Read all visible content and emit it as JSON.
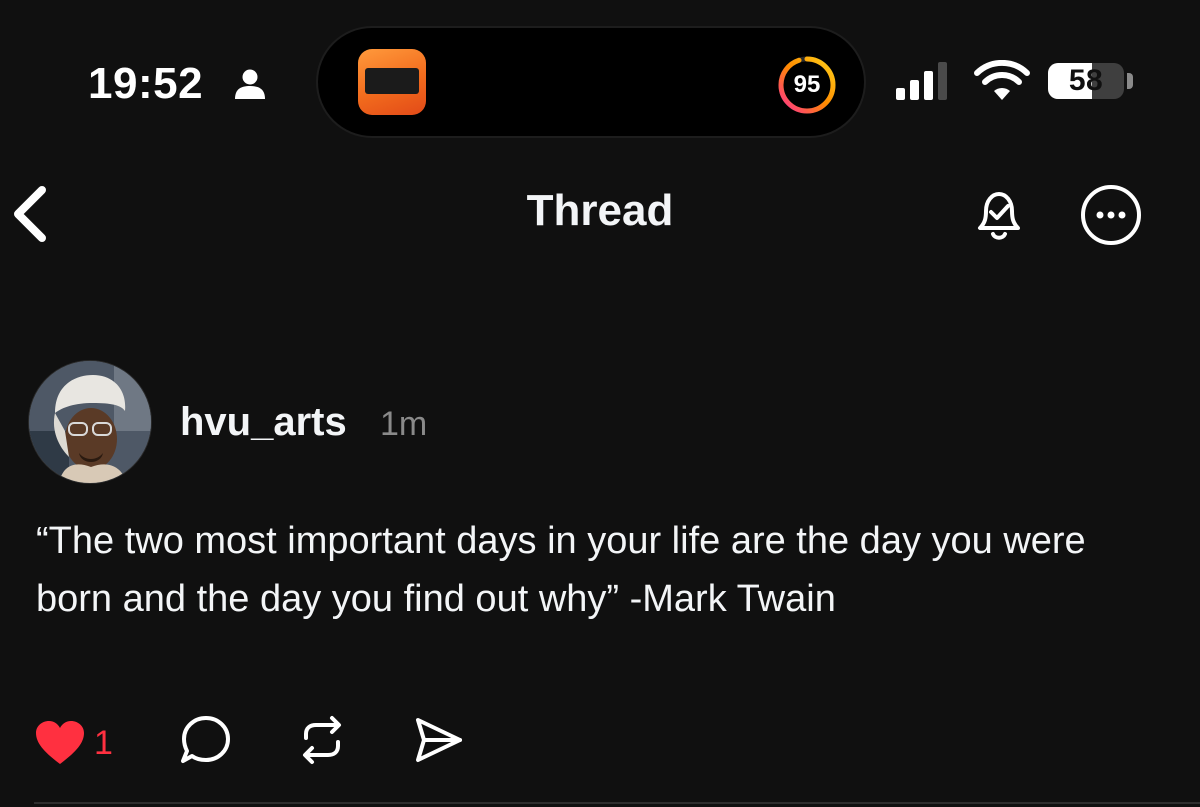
{
  "status_bar": {
    "time": "19:52",
    "ring_value": "95",
    "battery_level": "58",
    "battery_fraction": 0.58,
    "icons": [
      "person-icon",
      "cellular-signal-icon",
      "wifi-icon",
      "battery-icon"
    ]
  },
  "header": {
    "title": "Thread",
    "icons": [
      "back-chevron-icon",
      "bell-check-icon",
      "more-icon"
    ]
  },
  "post": {
    "username": "hvu_arts",
    "timestamp": "1m",
    "text": "“The two most important days in your life are the day you were born and the day you find out why” -Mark Twain",
    "like_count": "1",
    "action_icons": [
      "heart-icon",
      "reply-icon",
      "repost-icon",
      "share-icon"
    ]
  },
  "colors": {
    "background": "#101010",
    "text": "#f3f5f7",
    "muted": "#8a8a8a",
    "like": "#ff3040",
    "island_app": "#f26b1d"
  }
}
